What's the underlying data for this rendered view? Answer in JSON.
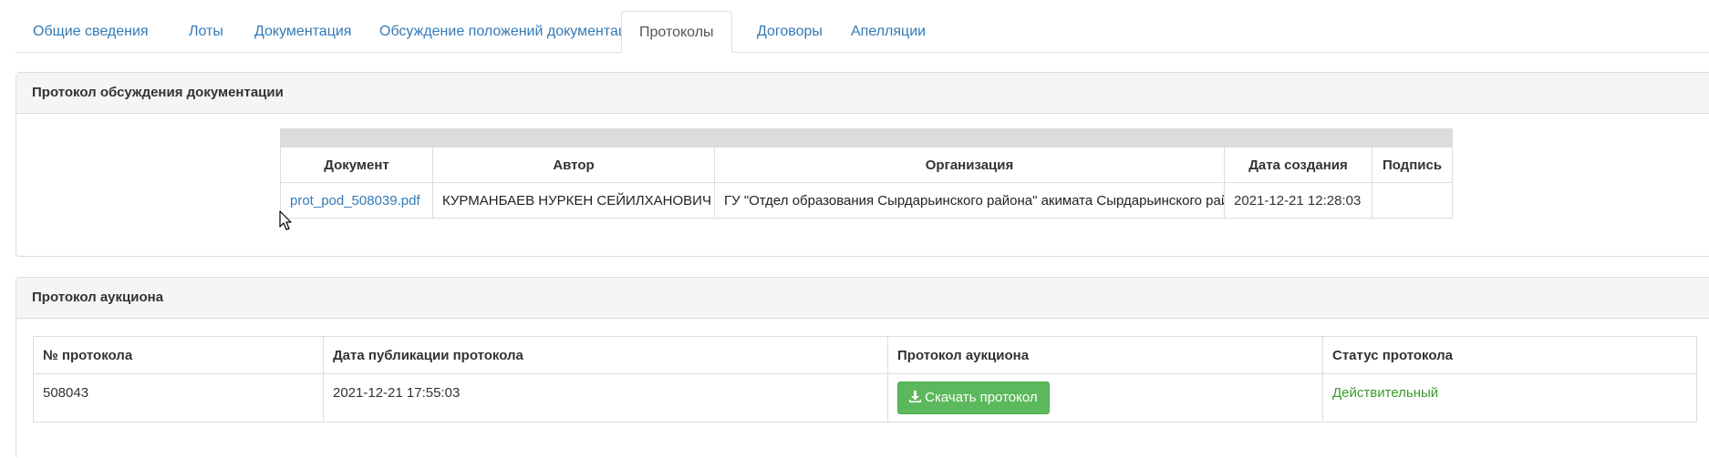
{
  "tabs": [
    {
      "label": "Общие сведения",
      "active": false
    },
    {
      "label": "Лоты",
      "active": false
    },
    {
      "label": "Документация",
      "active": false
    },
    {
      "label": "Обсуждение положений документации",
      "active": false
    },
    {
      "label": "Протоколы",
      "active": true
    },
    {
      "label": "Договоры",
      "active": false
    },
    {
      "label": "Апелляции",
      "active": false
    }
  ],
  "discussion_panel": {
    "title": "Протокол обсуждения документации",
    "columns": [
      "Документ",
      "Автор",
      "Организация",
      "Дата создания",
      "Подпись"
    ],
    "rows": [
      {
        "document": "prot_pod_508039.pdf",
        "author": "КУРМАНБАЕВ НУРКЕН СЕЙИЛХАНОВИЧ",
        "organization": "ГУ \"Отдел образования Сырдарьинского района\" акимата Сырдарьинского рай",
        "created": "2021-12-21 12:28:03",
        "signature": ""
      }
    ]
  },
  "auction_panel": {
    "title": "Протокол аукциона",
    "columns": [
      "№ протокола",
      "Дата публикации протокола",
      "Протокол аукциона",
      "Статус протокола"
    ],
    "rows": [
      {
        "number": "508043",
        "published": "2021-12-21 17:55:03",
        "download_label": "Скачать протокол",
        "status": "Действительный"
      }
    ]
  },
  "colors": {
    "link": "#337ab7",
    "success_button": "#5cb85c",
    "status_valid": "#3c9a2c"
  }
}
